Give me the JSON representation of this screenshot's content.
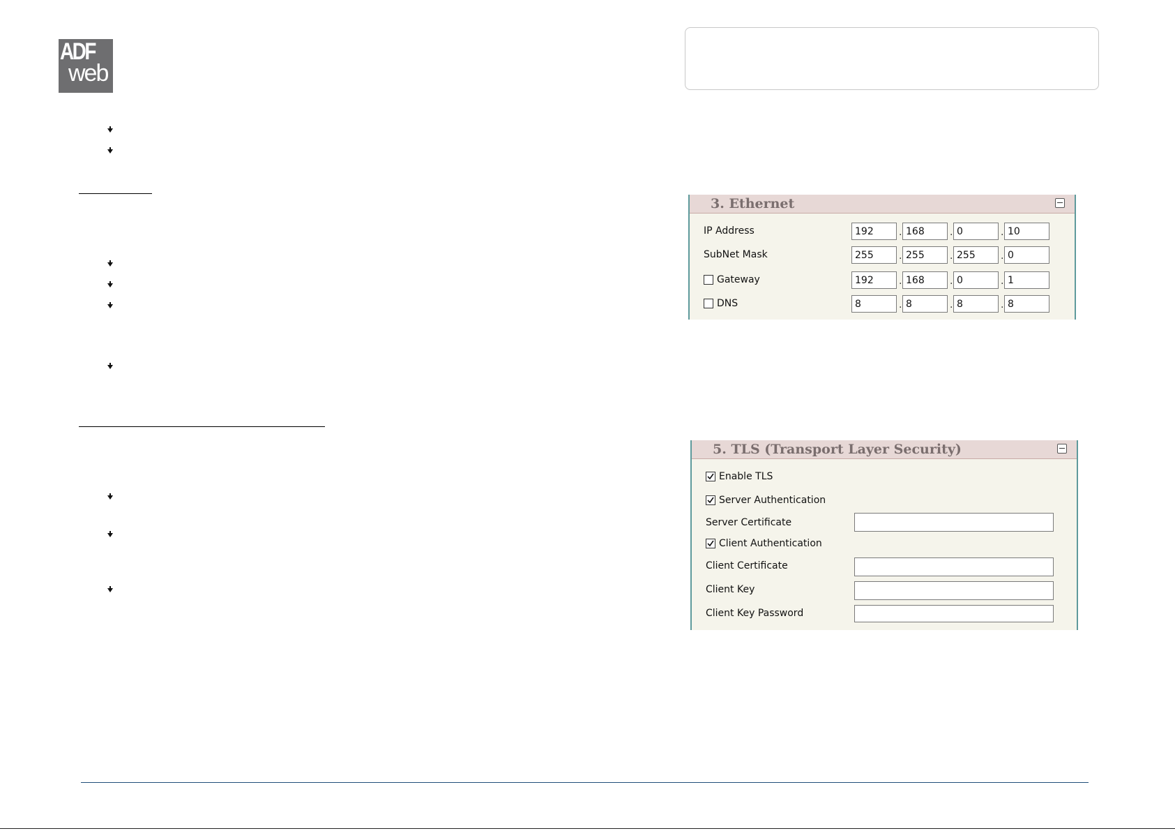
{
  "logo": {
    "line1": "ADF",
    "line2": "web"
  },
  "ethernet": {
    "title": "3. Ethernet",
    "rows": [
      {
        "label": "IP Address",
        "checkbox": false,
        "octets": [
          "192",
          "168",
          "0",
          "10"
        ]
      },
      {
        "label": "SubNet Mask",
        "checkbox": false,
        "octets": [
          "255",
          "255",
          "255",
          "0"
        ]
      },
      {
        "label": "Gateway",
        "checkbox": true,
        "checked": false,
        "octets": [
          "192",
          "168",
          "0",
          "1"
        ]
      },
      {
        "label": "DNS",
        "checkbox": true,
        "checked": false,
        "octets": [
          "8",
          "8",
          "8",
          "8"
        ]
      }
    ]
  },
  "tls": {
    "title": "5. TLS (Transport Layer Security)",
    "enable_tls": {
      "label": "Enable TLS",
      "checked": true
    },
    "server_auth": {
      "label": "Server Authentication",
      "checked": true
    },
    "server_certificate": {
      "label": "Server Certificate",
      "value": ""
    },
    "client_auth": {
      "label": "Client Authentication",
      "checked": true
    },
    "client_certificate": {
      "label": "Client Certificate",
      "value": ""
    },
    "client_key": {
      "label": "Client Key",
      "value": ""
    },
    "client_key_password": {
      "label": "Client Key Password",
      "value": ""
    }
  },
  "icons": {
    "bullet": "arrow-bullet-icon",
    "collapse": "collapse-minus-icon",
    "check": "checkmark-icon"
  },
  "colors": {
    "panel_header": "#e7d8d6",
    "panel_body": "#f5f4eb",
    "panel_border": "#5e9a9c",
    "panel_title": "#7a6e6e",
    "footer_rule": "#1f4e79"
  }
}
